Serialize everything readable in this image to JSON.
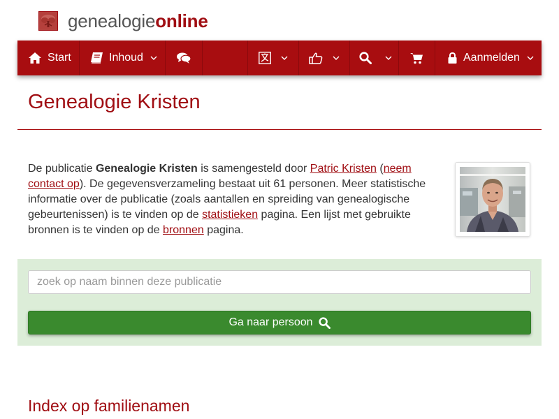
{
  "brand": {
    "part1": "genealogie",
    "part2": "online",
    "logo_icon": "tree-logo-icon",
    "accent_color": "#a00e13"
  },
  "nav": {
    "start": {
      "label": "Start",
      "icon": "home-icon"
    },
    "inhoud": {
      "label": "Inhoud",
      "icon": "book-icon"
    },
    "chat": {
      "icon": "comments-icon"
    },
    "language": {
      "icon": "language-icon"
    },
    "like": {
      "icon": "thumbs-up-icon"
    },
    "search": {
      "icon": "search-icon"
    },
    "cart": {
      "icon": "shopping-cart-icon"
    },
    "login": {
      "label": "Aanmelden",
      "icon": "lock-icon"
    }
  },
  "page": {
    "title": "Genealogie Kristen"
  },
  "intro": {
    "t1": "De publicatie ",
    "pub_name": "Genealogie Kristen",
    "t2": " is samengesteld door ",
    "author_link": "Patric Kristen",
    "t3": " (",
    "contact_link": "neem contact op",
    "t4": "). De gegevensverzameling bestaat uit 61 personen. Meer statistische informatie over de publicatie (zoals aantallen en spreiding van genealogische gebeurtenissen) is te vinden op de ",
    "stats_link": "statistieken",
    "t5": " pagina. Een lijst met gebruikte bronnen is te vinden op de ",
    "sources_link": "bronnen",
    "t6": " pagina."
  },
  "search": {
    "placeholder": "zoek op naam binnen deze publicatie",
    "value": "",
    "button_label": "Ga naar persoon",
    "button_icon": "search-icon",
    "button_color": "#3a8a2e",
    "panel_color": "#dcedd8"
  },
  "section": {
    "title": "Index op familienamen"
  }
}
